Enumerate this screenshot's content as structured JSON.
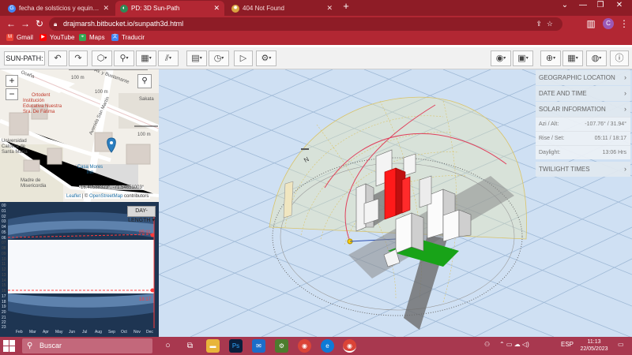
{
  "browser": {
    "tabs": [
      {
        "title": "fecha de solsticios y equinoccios",
        "active": false
      },
      {
        "title": "PD: 3D Sun-Path",
        "active": true
      },
      {
        "title": "404 Not Found",
        "active": false
      }
    ],
    "new_tab": "+",
    "url": "drajmarsh.bitbucket.io/sunpath3d.html",
    "profile_initial": "C",
    "bookmarks": [
      "Gmail",
      "YouTube",
      "Maps",
      "Traducir"
    ]
  },
  "app": {
    "title": "SUN-PATH:"
  },
  "map": {
    "street_labels": [
      "Ocaña",
      "Av. y Bustamante",
      "Avenida San Martín"
    ],
    "distance_labels": [
      "100 m",
      "100 m",
      "100 m"
    ],
    "poi_labels": {
      "ortodent": "Ortodent",
      "institucion": "Institución Educativa Nuestra Sra. De Fátima",
      "universidad": "Universidad Católica de Santa María",
      "casa_mores": "Casa Mores Inn",
      "madre": "Madre de Misericordia",
      "sakata": "Sakata"
    },
    "zoom_in": "+",
    "zoom_out": "−",
    "coordinates": "-16.40588323°, -71.54651003°",
    "attribution_leaflet": "Leaflet",
    "attribution_sep": " | © ",
    "attribution_osm": "OpenStreetMap",
    "attribution_suffix": " contributors"
  },
  "daylength": {
    "dropdown": "DAY-LENGTH",
    "hour_ticks": [
      "00",
      "01",
      "02",
      "03",
      "04",
      "05",
      "06",
      "07",
      "08",
      "09",
      "10",
      "11",
      "12",
      "13",
      "14",
      "15",
      "16",
      "17",
      "18",
      "19",
      "20",
      "21",
      "22",
      "23"
    ],
    "months": [
      "Feb",
      "Mar",
      "Apr",
      "May",
      "Jun",
      "Jul",
      "Aug",
      "Sep",
      "Oct",
      "Nov",
      "Dec"
    ],
    "sunrise_time": "05:11",
    "sunset_time": "18:17"
  },
  "panel": {
    "geographic_location": "GEOGRAPHIC LOCATION",
    "date_and_time": "DATE AND TIME",
    "solar_information": "SOLAR INFORMATION",
    "azi_alt_label": "Azi / Alt:",
    "azi_alt_value": "-107.76° / 31.94°",
    "rise_set_label": "Rise / Set:",
    "rise_set_value": "05:11 / 18:17",
    "daylight_label": "Daylight:",
    "daylight_value": "13:06 Hrs",
    "twilight_times": "TWILIGHT TIMES"
  },
  "scene": {
    "compass_n": "N"
  },
  "taskbar": {
    "search_placeholder": "Buscar",
    "language": "ESP",
    "time": "11:13",
    "date": "22/05/2023"
  }
}
